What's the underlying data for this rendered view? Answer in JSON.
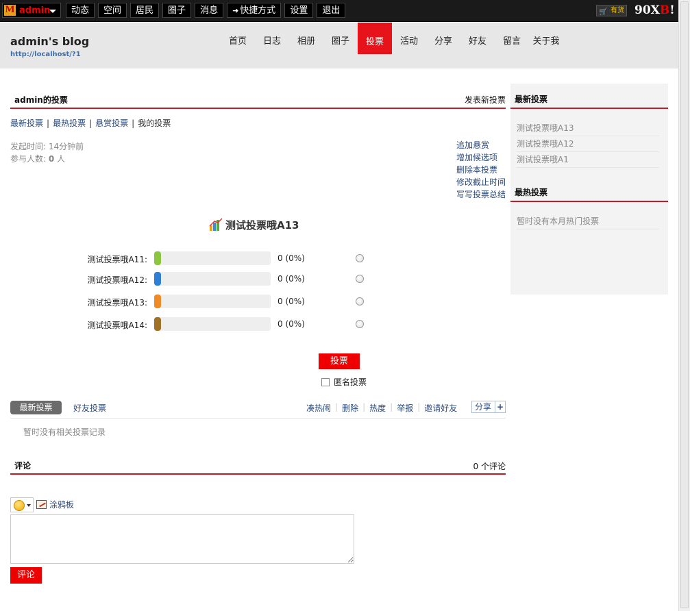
{
  "topbar": {
    "logo_letter": "M",
    "username": "admin",
    "items": [
      "动态",
      "空间",
      "居民",
      "圈子",
      "消息",
      "快捷方式",
      "设置",
      "退出"
    ],
    "shortcut_arrow": "➜",
    "cart_label": "有货",
    "brand_prefix": "90X",
    "brand_b": "B",
    "brand_suffix": "!"
  },
  "header": {
    "blog_title": "admin's blog",
    "blog_url": "http://localhost/?1",
    "nav": [
      "首页",
      "日志",
      "相册",
      "圈子",
      "投票",
      "活动",
      "分享",
      "好友",
      "留言",
      "关于我"
    ],
    "active_nav": "投票"
  },
  "main": {
    "section_title": "admin的投票",
    "new_poll_link": "发表新投票",
    "subnav": {
      "latest": "最新投票",
      "hot": "最热投票",
      "reward": "悬赏投票",
      "mine": "我的投票",
      "sep": "|"
    },
    "meta": {
      "start_label": "发起时间: ",
      "start_value": "14分钟前",
      "participants_label": "参与人数: ",
      "participants_value": "0",
      "participants_unit": " 人"
    },
    "ops": [
      "追加悬赏",
      "增加候选项",
      "删除本投票",
      "修改截止时间",
      "写写投票总结"
    ],
    "poll": {
      "title": "测试投票哦A13",
      "options": [
        {
          "label": "测试投票哦A11:",
          "count": "0 (0%)",
          "percent": 0,
          "color": "#8cc63f"
        },
        {
          "label": "测试投票哦A12:",
          "count": "0 (0%)",
          "percent": 0,
          "color": "#2f7fd8"
        },
        {
          "label": "测试投票哦A13:",
          "count": "0 (0%)",
          "percent": 0,
          "color": "#f08a24"
        },
        {
          "label": "测试投票哦A14:",
          "count": "0 (0%)",
          "percent": 0,
          "color": "#a07226"
        }
      ],
      "vote_button": "投票",
      "anonymous_label": "匿名投票"
    },
    "tabs": {
      "latest": "最新投票",
      "friends": "好友投票",
      "actions": [
        "凑热闹",
        "删除",
        "热度",
        "举报",
        "邀请好友"
      ],
      "share": "分享",
      "share_plus": "+"
    },
    "empty_note": "暂时没有相关投票记录",
    "comments": {
      "title": "评论",
      "count": "0 个评论",
      "doodle": "涂鸦板",
      "submit": "评论"
    }
  },
  "sidebar": {
    "latest_title": "最新投票",
    "latest_items": [
      "测试投票哦A13",
      "测试投票哦A12",
      "测试投票哦A1"
    ],
    "hot_title": "最热投票",
    "hot_items": [
      "暂时没有本月热门投票"
    ]
  }
}
